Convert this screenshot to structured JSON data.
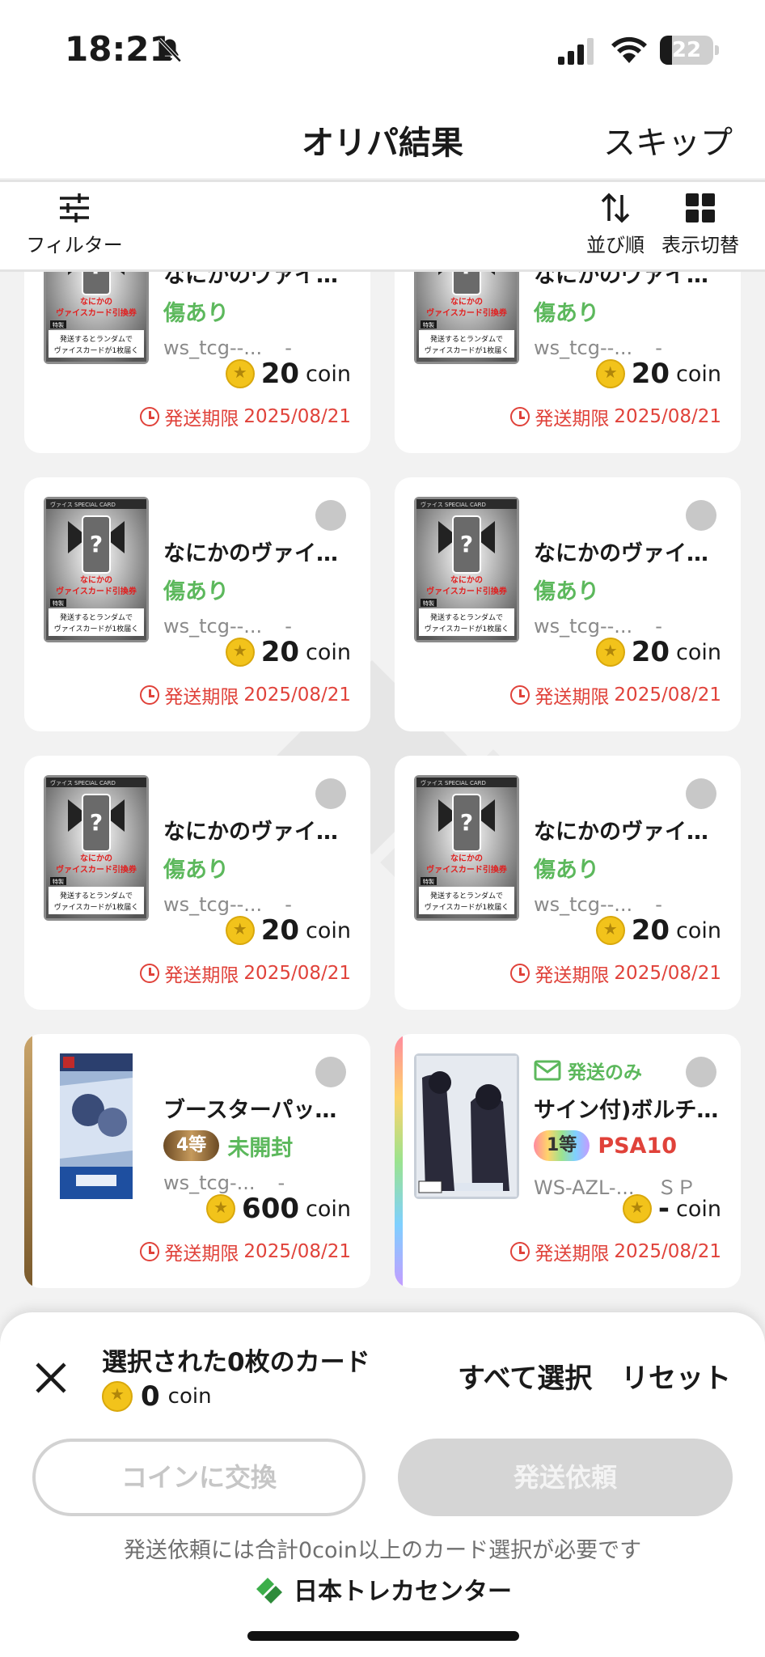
{
  "status_bar": {
    "time": "18:21",
    "battery": "22",
    "battery_level": 0.22,
    "icons": [
      "bell-slash-icon",
      "signal-icon",
      "wifi-icon",
      "battery-icon"
    ]
  },
  "header": {
    "title": "オリパ結果",
    "skip": "スキップ"
  },
  "toolbar": {
    "filter": "フィルター",
    "sort": "並び順",
    "view": "表示切替"
  },
  "cards": [
    {
      "name": "なにかのヴァイ…",
      "condition": "傷あり",
      "code": "ws_tcg--...",
      "rarity": "-",
      "price": "20",
      "unit": "coin",
      "deadline_label": "発送期限",
      "deadline": "2025/08/21"
    },
    {
      "name": "なにかのヴァイ…",
      "condition": "傷あり",
      "code": "ws_tcg--...",
      "rarity": "-",
      "price": "20",
      "unit": "coin",
      "deadline_label": "発送期限",
      "deadline": "2025/08/21"
    },
    {
      "name": "なにかのヴァイ…",
      "condition": "傷あり",
      "code": "ws_tcg--...",
      "rarity": "-",
      "price": "20",
      "unit": "coin",
      "deadline_label": "発送期限",
      "deadline": "2025/08/21"
    },
    {
      "name": "なにかのヴァイ…",
      "condition": "傷あり",
      "code": "ws_tcg--...",
      "rarity": "-",
      "price": "20",
      "unit": "coin",
      "deadline_label": "発送期限",
      "deadline": "2025/08/21"
    },
    {
      "name": "なにかのヴァイ…",
      "condition": "傷あり",
      "code": "ws_tcg--...",
      "rarity": "-",
      "price": "20",
      "unit": "coin",
      "deadline_label": "発送期限",
      "deadline": "2025/08/21"
    },
    {
      "name": "なにかのヴァイ…",
      "condition": "傷あり",
      "code": "ws_tcg--...",
      "rarity": "-",
      "price": "20",
      "unit": "coin",
      "deadline_label": "発送期限",
      "deadline": "2025/08/21"
    },
    {
      "name": "ブースターパッ…",
      "rank": "4等",
      "condition": "未開封",
      "code": "ws_tcg-...",
      "rarity": "-",
      "price": "600",
      "unit": "coin",
      "deadline_label": "発送期限",
      "deadline": "2025/08/21"
    },
    {
      "name": "サイン付)ボルチ…",
      "ship_only": "発送のみ",
      "rank": "1等",
      "condition": "PSA10",
      "code": "WS-AZL-...",
      "rarity": "ＳＰ",
      "price": "-",
      "unit": "coin",
      "deadline_label": "発送期限",
      "deadline": "2025/08/21"
    }
  ],
  "ticket_art": {
    "top": "ヴァイス SPECIAL CARD",
    "title1": "なにかの",
    "title2": "ヴァイスカード引換券",
    "tag": "特製",
    "line1": "発送するとランダムで",
    "line2": "ヴァイスカードが1枚届く"
  },
  "bottom": {
    "selected_label": "選択された0枚のカード",
    "selected_coin": "0",
    "coin_unit": "coin",
    "select_all": "すべて選択",
    "reset": "リセット",
    "exchange": "コインに交換",
    "ship_request": "発送依頼",
    "hint": "発送依頼には合計0coin以上のカード選択が必要です",
    "brand": "日本トレカセンター"
  },
  "colors": {
    "accent_green": "#5cb85c",
    "deadline_red": "#e0423a",
    "coin_gold": "#f2c31b"
  }
}
